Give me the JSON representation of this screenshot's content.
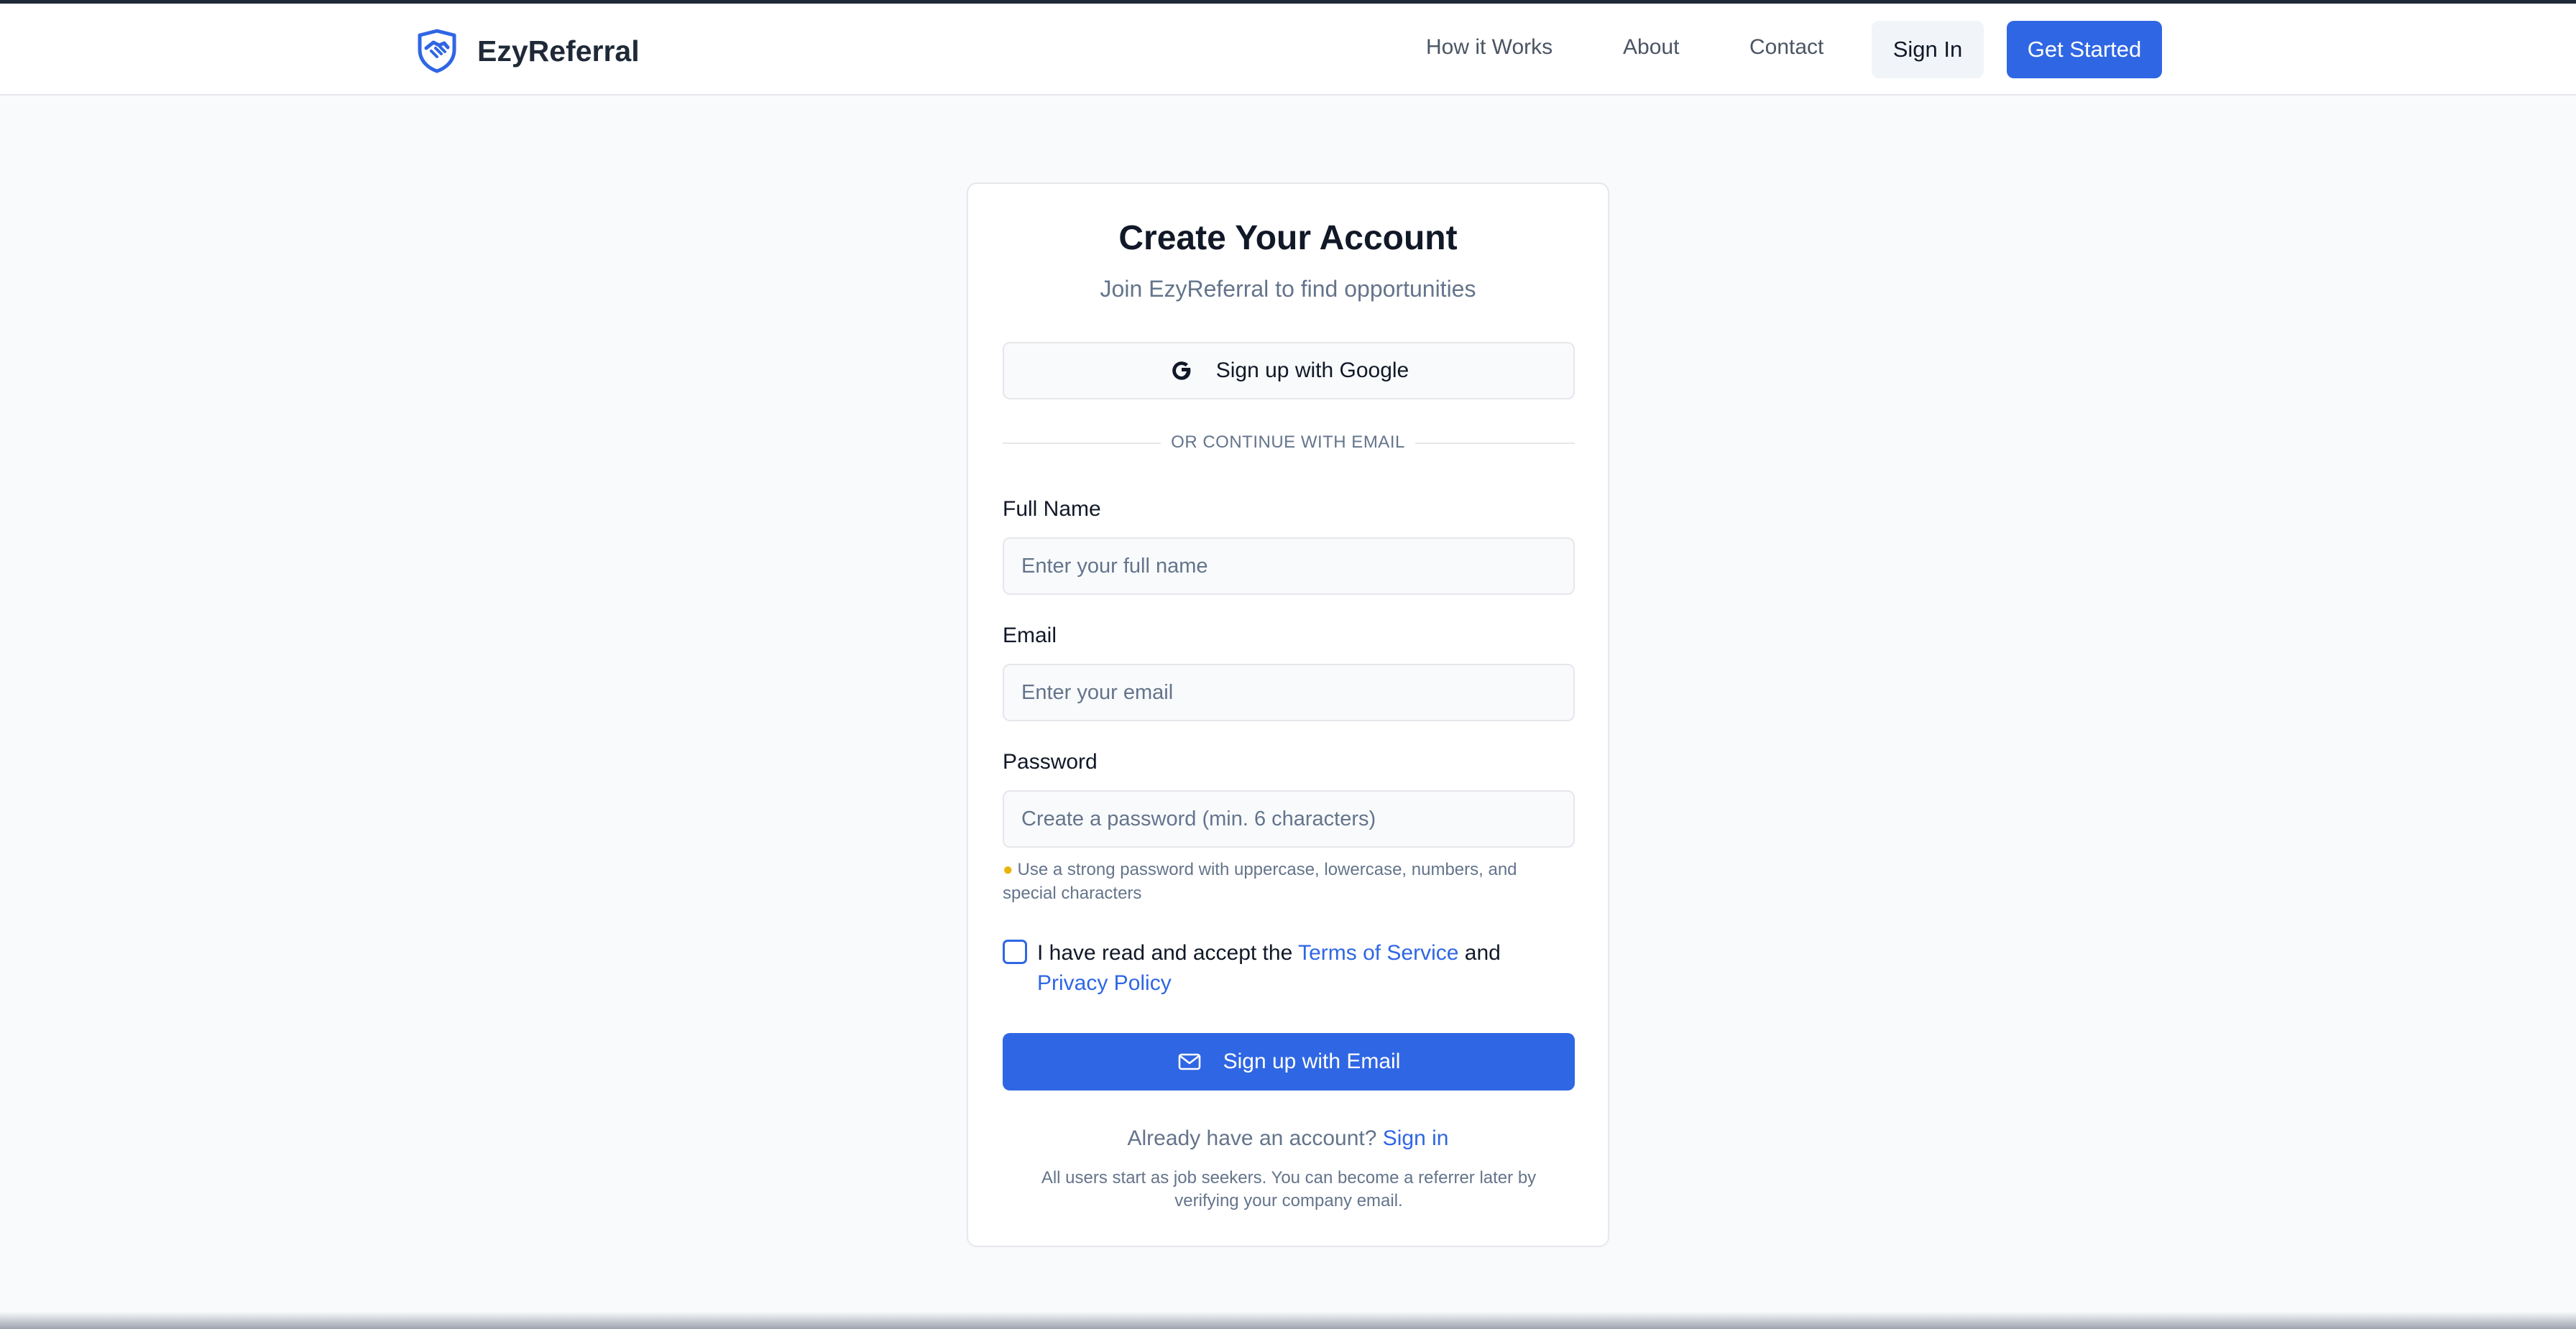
{
  "navbar": {
    "brand_name": "EzyReferral",
    "brand_icon": "handshake-shield-icon",
    "links": [
      "How it Works",
      "About",
      "Contact"
    ],
    "sign_in_label": "Sign In",
    "get_started_label": "Get Started"
  },
  "signup": {
    "title": "Create Your Account",
    "subtitle": "Join EzyReferral to find opportunities",
    "google_button_label": "Sign up with Google",
    "divider_text": "OR CONTINUE WITH EMAIL",
    "full_name": {
      "label": "Full Name",
      "placeholder": "Enter your full name",
      "value": ""
    },
    "email": {
      "label": "Email",
      "placeholder": "Enter your email",
      "value": ""
    },
    "password": {
      "label": "Password",
      "placeholder": "Create a password (min. 6 characters)",
      "value": ""
    },
    "password_hint": "Use a strong password with uppercase, lowercase, numbers, and special characters",
    "terms": {
      "checked": false,
      "prefix": "I have read and accept the",
      "terms_link": "Terms of Service",
      "conjunction": "and",
      "privacy_link": "Privacy Policy"
    },
    "email_button_label": "Sign up with Email",
    "already_text": "Already have an account?",
    "sign_in_link": "Sign in",
    "note": "All users start as job seekers. You can become a referrer later by verifying your company email."
  },
  "colors": {
    "accent": "#2f66e4",
    "page_background": "#f8fafc",
    "muted_text": "#64748b",
    "border": "#e5e7eb"
  }
}
